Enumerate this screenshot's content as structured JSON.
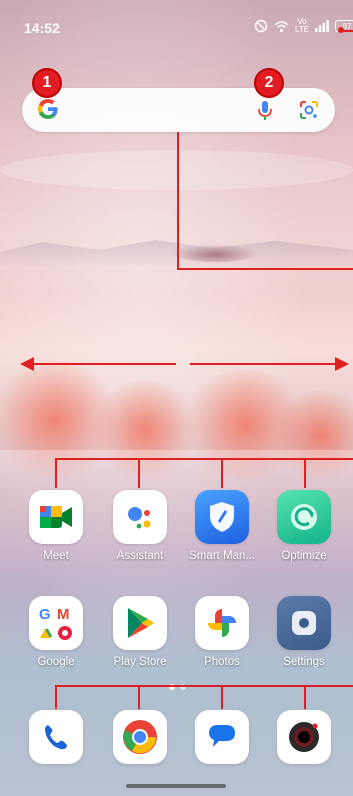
{
  "status_bar": {
    "time": "14:52",
    "network_top": "Vo",
    "network_bottom": "LTE",
    "battery": "87"
  },
  "search_bar": {
    "badges": [
      "1",
      "2"
    ]
  },
  "home": {
    "row1": [
      {
        "label": "Meet",
        "icon": "meet-icon"
      },
      {
        "label": "Assistant",
        "icon": "assistant-icon"
      },
      {
        "label": "Smart Man...",
        "icon": "smart-manager-icon"
      },
      {
        "label": "Optimize",
        "icon": "optimize-icon"
      }
    ],
    "row2": [
      {
        "label": "Google",
        "icon": "google-folder-icon"
      },
      {
        "label": "Play Store",
        "icon": "play-store-icon"
      },
      {
        "label": "Photos",
        "icon": "photos-icon"
      },
      {
        "label": "Settings",
        "icon": "settings-icon"
      }
    ]
  },
  "dock": [
    {
      "icon": "phone-icon"
    },
    {
      "icon": "chrome-icon"
    },
    {
      "icon": "messages-icon"
    },
    {
      "icon": "camera-icon"
    }
  ],
  "colors": {
    "annotation": "#e02020",
    "google_blue": "#4285f4"
  }
}
